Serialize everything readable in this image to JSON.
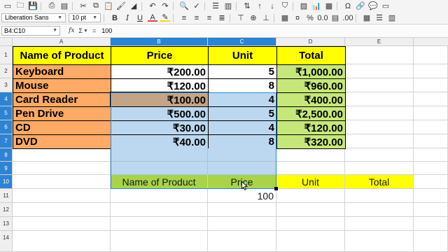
{
  "toolbar": {
    "font_name": "Liberation Sans",
    "font_size": "10 pt",
    "bold_label": "B",
    "italic_label": "I",
    "underline_label": "U"
  },
  "formula_bar": {
    "name_box": "B4:C10",
    "fx_label": "fx",
    "sum_label": "Σ",
    "eq_label": "=",
    "content": "100"
  },
  "columns": [
    "A",
    "B",
    "C",
    "D",
    "E"
  ],
  "rows": [
    "1",
    "2",
    "3",
    "4",
    "5",
    "6",
    "7",
    "8",
    "9",
    "10",
    "11",
    "12",
    "13",
    "14"
  ],
  "table": {
    "headers": [
      "Name of Product",
      "Price",
      "Unit",
      "Total"
    ],
    "data": [
      [
        "Keyboard",
        "₹200.00",
        "5",
        "₹1,000.00"
      ],
      [
        "Mouse",
        "₹120.00",
        "8",
        "₹960.00"
      ],
      [
        "Card Reader",
        "₹100.00",
        "4",
        "₹400.00"
      ],
      [
        "Pen Drive",
        "₹500.00",
        "5",
        "₹2,500.00"
      ],
      [
        "CD",
        "₹30.00",
        "4",
        "₹120.00"
      ],
      [
        "DVD",
        "₹40.00",
        "8",
        "₹320.00"
      ]
    ]
  },
  "row10": [
    "Name of Product",
    "Price",
    "Unit",
    "Total"
  ],
  "c11_value": "100",
  "colors": {
    "header_yellow": "#ffff00",
    "orange": "#ffaa66",
    "green": "#c6e77a",
    "selection_blue": "#bcd8f0",
    "active_cell": "#c3a487",
    "row10_green": "#a8d34a",
    "header_selected": "#2d84d4"
  }
}
